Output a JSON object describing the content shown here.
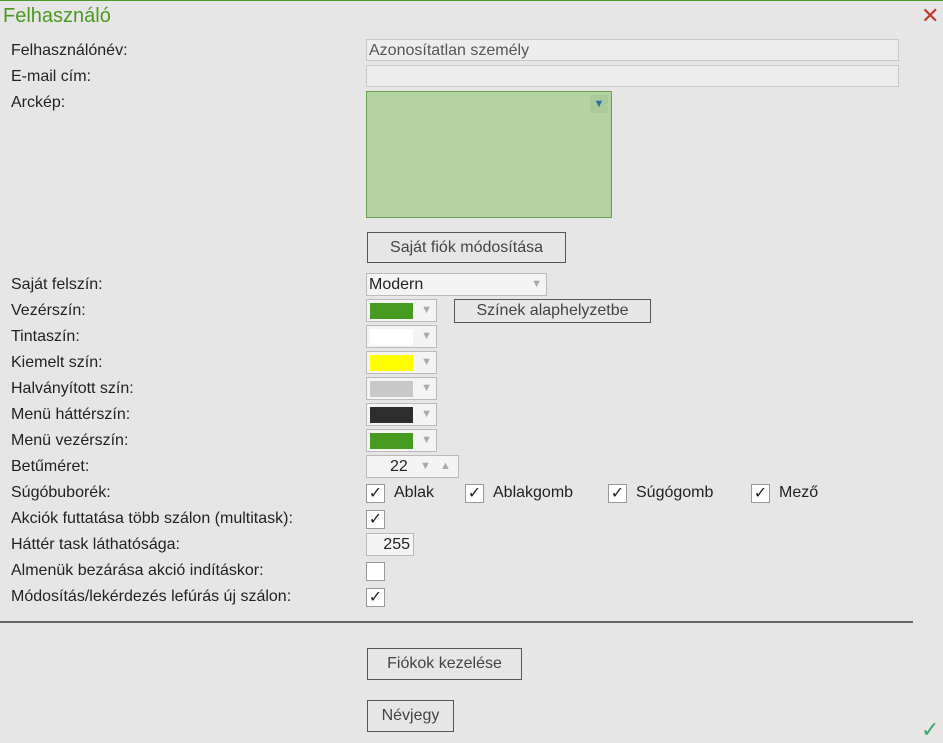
{
  "title": "Felhasználó",
  "close_icon": "close-icon",
  "ok_icon": "check-icon",
  "fields": {
    "username_label": "Felhasználónév:",
    "username_value": "Azonosítatlan személy",
    "email_label": "E-mail cím:",
    "email_value": "",
    "photo_label": "Arckép:"
  },
  "buttons": {
    "edit_account": "Saját fiók módosítása",
    "reset_colors": "Színek alaphelyzetbe",
    "manage_accounts": "Fiókok kezelése",
    "about": "Névjegy"
  },
  "skin": {
    "label": "Saját felszín:",
    "value": "Modern"
  },
  "colors": [
    {
      "label": "Vezérszín:",
      "color": "#459a1f"
    },
    {
      "label": "Tintaszín:",
      "color": "#ffffff"
    },
    {
      "label": "Kiemelt szín:",
      "color": "#ffff00"
    },
    {
      "label": "Halványított szín:",
      "color": "#c8c8c8"
    },
    {
      "label": "Menü háttérszín:",
      "color": "#2d2d2d"
    },
    {
      "label": "Menü vezérszín:",
      "color": "#459a1f"
    }
  ],
  "font_size": {
    "label": "Betűméret:",
    "value": "22"
  },
  "tooltips": {
    "label": "Súgóbuborék:",
    "options": [
      {
        "label": "Ablak",
        "checked": true
      },
      {
        "label": "Ablakgomb",
        "checked": true
      },
      {
        "label": "Súgógomb",
        "checked": true
      },
      {
        "label": "Mező",
        "checked": true
      }
    ]
  },
  "multitask": {
    "label": "Akciók futtatása több szálon (multitask):",
    "checked": true
  },
  "bg_task": {
    "label": "Háttér task láthatósága:",
    "value": "255"
  },
  "close_submenus": {
    "label": "Almenük bezárása akció indításkor:",
    "checked": false
  },
  "new_thread": {
    "label": "Módosítás/lekérdezés lefúrás új szálon:",
    "checked": true
  }
}
